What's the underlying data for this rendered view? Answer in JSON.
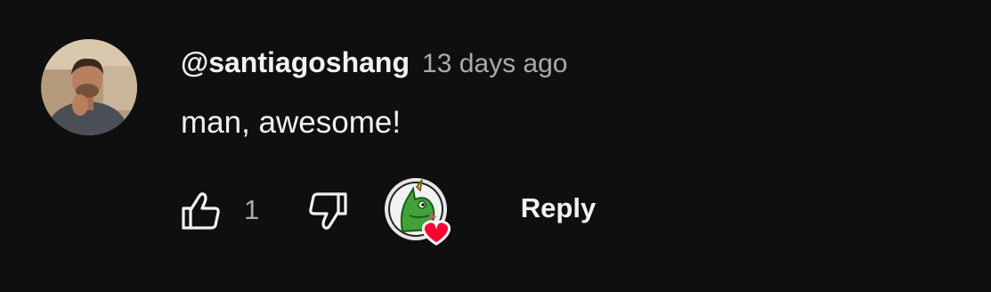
{
  "comment": {
    "author": "@santiagoshang",
    "timestamp": "13 days ago",
    "text": "man, awesome!",
    "avatar_icon": "user-avatar-photo"
  },
  "actions": {
    "like_icon": "thumbs-up-icon",
    "like_count": "1",
    "dislike_icon": "thumbs-down-icon",
    "creator_heart_icon": "creator-heart-badge",
    "reply_label": "Reply"
  },
  "colors": {
    "background": "#0f0f0f",
    "primary_text": "#f1f1f1",
    "secondary_text": "#aaaaaa",
    "heart": "#ff0033"
  }
}
